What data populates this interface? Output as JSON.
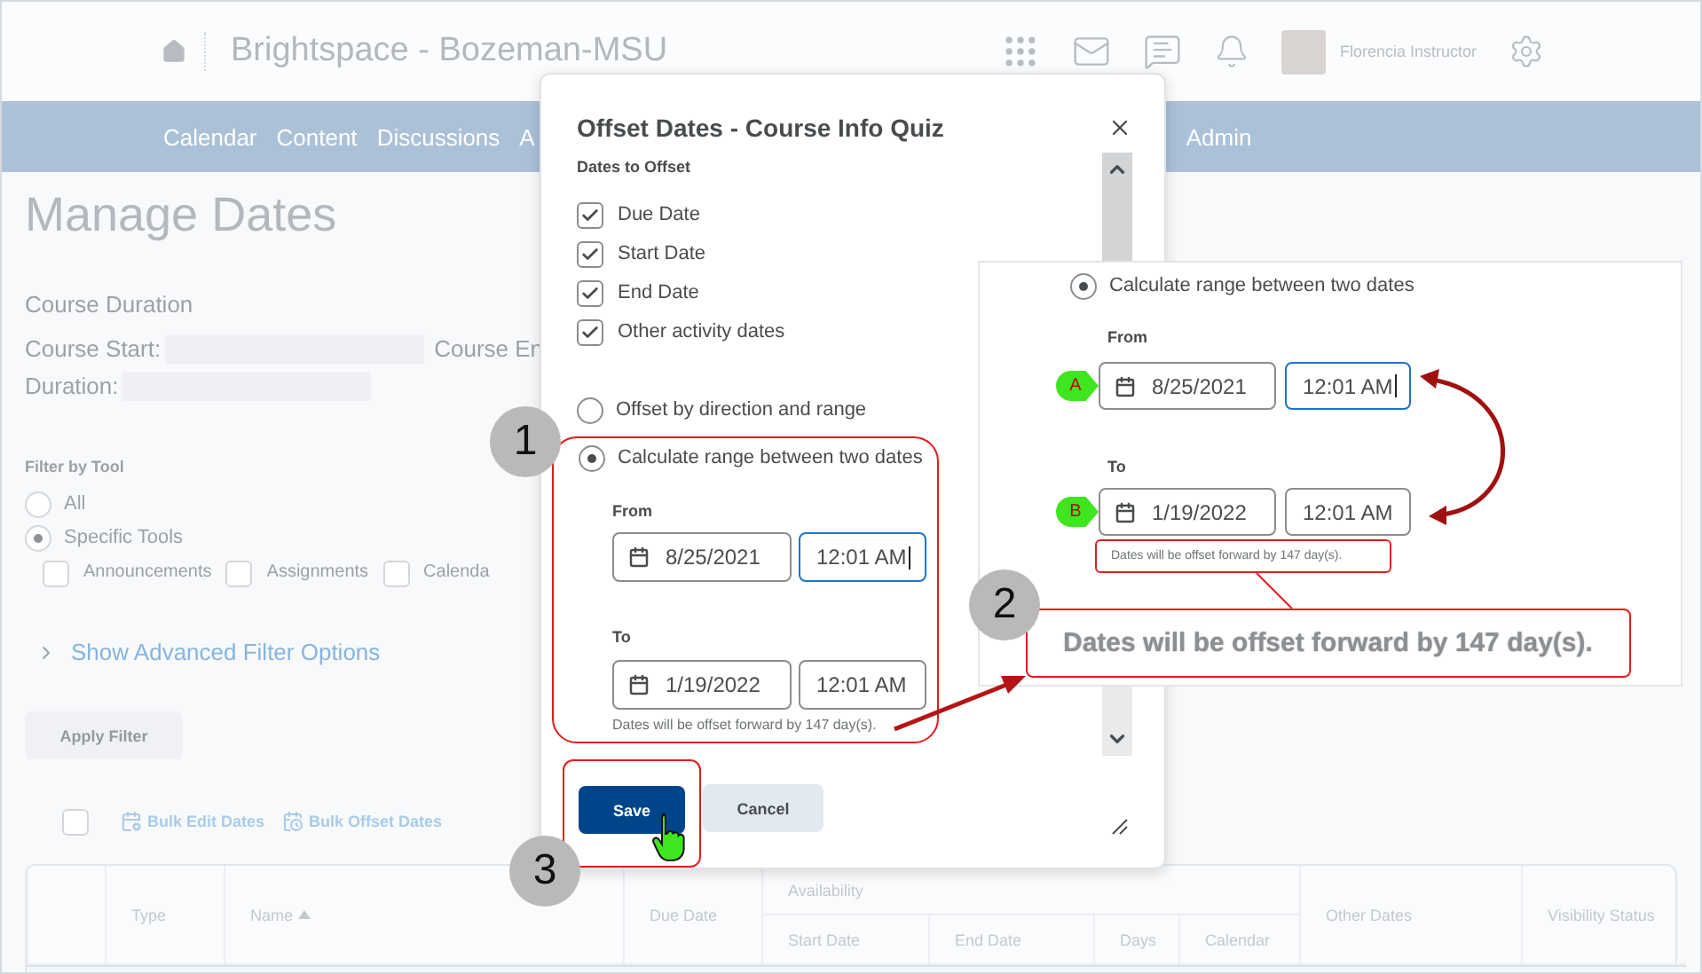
{
  "header": {
    "title": "Brightspace - Bozeman-MSU",
    "user_name": "Florencia Instructor"
  },
  "nav": {
    "items": [
      "Calendar",
      "Content",
      "Discussions",
      "A",
      "Admin"
    ]
  },
  "page": {
    "title": "Manage Dates",
    "duration_heading": "Course Duration",
    "course_start_label": "Course Start:",
    "course_end_label": "Course En",
    "duration_label": "Duration:",
    "filter": {
      "label": "Filter by Tool",
      "options": [
        {
          "label": "All",
          "selected": false
        },
        {
          "label": "Specific Tools",
          "selected": true
        }
      ],
      "tools": [
        {
          "label": "Announcements",
          "checked": false
        },
        {
          "label": "Assignments",
          "checked": false
        },
        {
          "label": "Calenda",
          "checked": false
        }
      ],
      "advanced_link": "Show Advanced Filter Options",
      "apply_button": "Apply Filter"
    },
    "select_all_checked": false,
    "bulk_actions": [
      {
        "label": "Bulk Edit Dates",
        "kind": "edit"
      },
      {
        "label": "Bulk Offset Dates",
        "kind": "offset"
      }
    ],
    "table": {
      "columns": [
        {
          "label": "Type",
          "sorted": false
        },
        {
          "label": "Name",
          "sorted": true
        },
        {
          "label": "Due Date",
          "sorted": false
        }
      ],
      "group": {
        "label": "Availability",
        "columns": [
          "Start Date",
          "End Date",
          "Days",
          "Calendar"
        ]
      },
      "columns_after": [
        "Other Dates",
        "Visibility Status"
      ]
    }
  },
  "dialog": {
    "title": "Offset Dates - Course Info Quiz",
    "section_label": "Dates to Offset",
    "date_types": [
      {
        "label": "Due Date",
        "checked": true
      },
      {
        "label": "Start Date",
        "checked": true
      },
      {
        "label": "End Date",
        "checked": true
      },
      {
        "label": "Other activity dates",
        "checked": true
      }
    ],
    "modes": [
      {
        "label": "Offset by direction and range",
        "selected": false
      },
      {
        "label": "Calculate range between two dates",
        "selected": true
      }
    ],
    "from": {
      "label": "From",
      "date": "8/25/2021",
      "time": "12:01 AM",
      "focused": true
    },
    "to": {
      "label": "To",
      "date": "1/19/2022",
      "time": "12:01 AM",
      "focused": false
    },
    "note": "Dates will be offset forward by 147 day(s).",
    "buttons": [
      {
        "label": "Save",
        "kind": "primary"
      },
      {
        "label": "Cancel",
        "kind": "secondary"
      }
    ]
  },
  "inset": {
    "mode": {
      "label": "Calculate range between two dates",
      "selected": true
    },
    "from": {
      "label": "From",
      "marker": "A",
      "date": "8/25/2021",
      "time": "12:01 AM",
      "focused": true
    },
    "to": {
      "label": "To",
      "marker": "B",
      "date": "1/19/2022",
      "time": "12:01 AM",
      "focused": false
    },
    "note": "Dates will be offset forward by 147 day(s).",
    "zoomed_note": "Dates will be offset forward by 147 day(s)."
  },
  "callouts": [
    "1",
    "2",
    "3"
  ]
}
